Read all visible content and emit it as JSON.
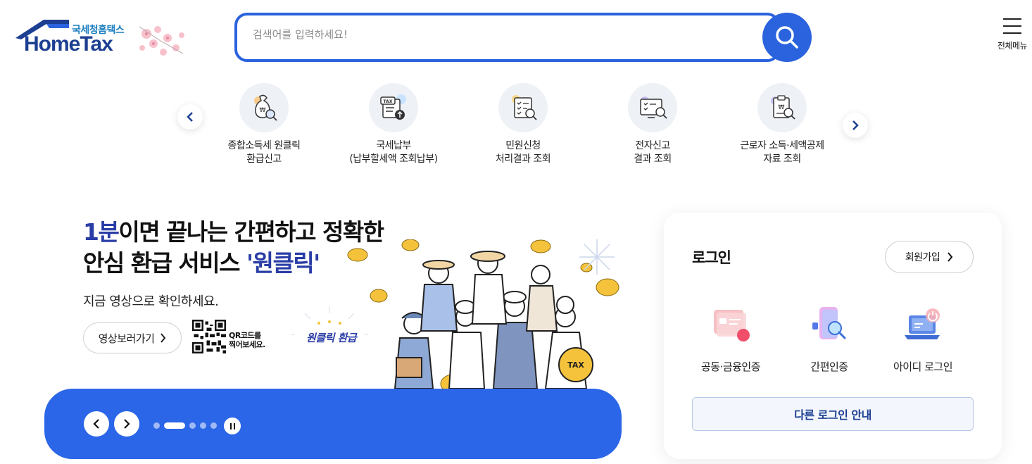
{
  "header": {
    "logo_sub": "국세청홈택스",
    "logo_main": "HomeTax",
    "search_placeholder": "검색어를 입력하세요!",
    "menu_label": "전체메뉴"
  },
  "quick_menu": {
    "items": [
      {
        "label": "종합소득세 원클릭\n환급신고",
        "icon": "money-bag-search-icon"
      },
      {
        "label": "국세납부\n(납부할세액 조회납부)",
        "icon": "tax-payment-icon"
      },
      {
        "label": "민원신청\n처리결과 조회",
        "icon": "document-search-icon"
      },
      {
        "label": "전자신고\n결과 조회",
        "icon": "monitor-search-icon"
      },
      {
        "label": "근로자 소득·세액공제\n자료 조회",
        "icon": "receipt-search-icon"
      }
    ]
  },
  "banner": {
    "headline_highlight": "1분",
    "headline_rest1": "이면 끝나는 간편하고 정확한",
    "headline_line2_prefix": "안심 환급 서비스 ",
    "headline_line2_highlight": "'원클릭'",
    "sub": "지금 영상으로 확인하세요.",
    "video_button": "영상보러가기",
    "qr_text": "QR코드를\n찍어보세요.",
    "bubble_text": "원클릭 환급",
    "tax_bag_text": "TAX",
    "slides_total": 5,
    "slide_current": 2
  },
  "login": {
    "title": "로그인",
    "signup": "회원가입",
    "options": [
      {
        "label": "공동·금융인증",
        "icon": "certificate-card-icon"
      },
      {
        "label": "간편인증",
        "icon": "phone-auth-icon"
      },
      {
        "label": "아이디 로그인",
        "icon": "laptop-login-icon"
      }
    ],
    "other_login": "다른 로그인 안내"
  },
  "colors": {
    "brand_blue": "#2b63de",
    "banner_blue": "#2b66e8",
    "logo_navy": "#1d3f91",
    "headline_blue": "#2a3da6"
  }
}
